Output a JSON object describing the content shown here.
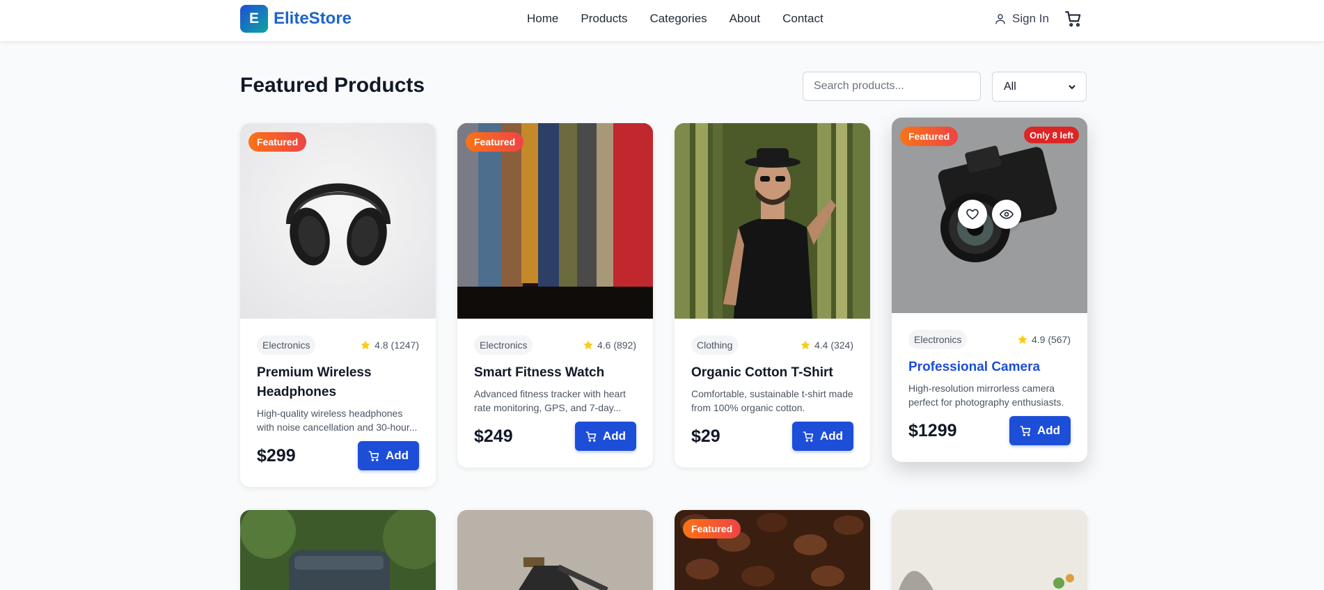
{
  "brand": {
    "logo_letter": "E",
    "name": "EliteStore"
  },
  "nav": [
    "Home",
    "Products",
    "Categories",
    "About",
    "Contact"
  ],
  "account": {
    "signin": "Sign In"
  },
  "page": {
    "title": "Featured Products"
  },
  "search": {
    "placeholder": "Search products...",
    "value": ""
  },
  "filter": {
    "selected": "All"
  },
  "colors": {
    "accent": "#1d4ed8",
    "featured_badge": "#f97316",
    "stock_badge": "#dc2626",
    "star": "#facc15"
  },
  "products": [
    {
      "badge": "Featured",
      "category": "Electronics",
      "rating": "4.8",
      "reviews": "(1247)",
      "name": "Premium Wireless Headphones",
      "description": "High-quality wireless headphones with noise cancellation and 30-hour...",
      "price": "$299",
      "add": "Add"
    },
    {
      "badge": "Featured",
      "category": "Electronics",
      "rating": "4.6",
      "reviews": "(892)",
      "name": "Smart Fitness Watch",
      "description": "Advanced fitness tracker with heart rate monitoring, GPS, and 7-day...",
      "price": "$249",
      "add": "Add"
    },
    {
      "category": "Clothing",
      "rating": "4.4",
      "reviews": "(324)",
      "name": "Organic Cotton T-Shirt",
      "description": "Comfortable, sustainable t-shirt made from 100% organic cotton.",
      "price": "$29",
      "add": "Add"
    },
    {
      "badge": "Featured",
      "stock": "Only 8 left",
      "category": "Electronics",
      "rating": "4.9",
      "reviews": "(567)",
      "name": "Professional Camera",
      "description": "High-resolution mirrorless camera perfect for photography enthusiasts.",
      "price": "$1299",
      "add": "Add"
    }
  ],
  "second_row": [
    {
      "image": "backpack-photo"
    },
    {
      "image": "desk-lamp-photo"
    },
    {
      "image": "coffee-beans-photo",
      "badge": "Featured"
    },
    {
      "image": "plant-decor-photo"
    }
  ]
}
